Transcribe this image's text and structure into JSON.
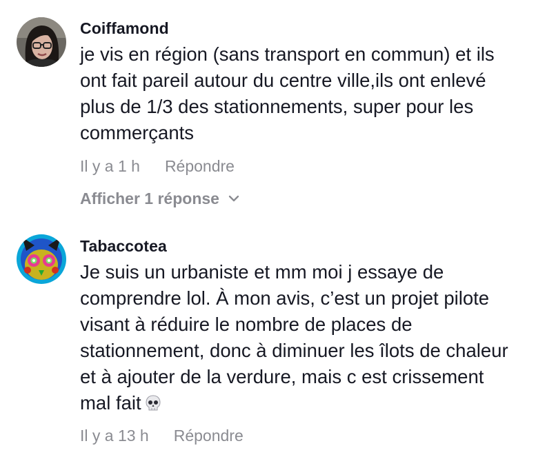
{
  "comments": [
    {
      "username": "Coiffamond",
      "text": "je vis en région (sans transport en commun) et ils\nont fait pareil autour du centre ville,ils ont enlevé\nplus de 1/3 des stationnements, super pour les\ncommerçants",
      "time": "Il y a 1 h",
      "reply_label": "Répondre",
      "view_replies_label": "Afficher 1 réponse",
      "avatar_icon": "woman-avatar-icon"
    },
    {
      "username": "Tabaccotea",
      "text": "Je suis un urbaniste et mm moi j essaye de\ncomprendre lol. À mon avis, c’est un projet pilote\nvisant à réduire le nombre de places de\nstationnement, donc à diminuer les îlots de chaleur\net à ajouter de la verdure, mais c est crissement\nmal fait",
      "emoji": "skull-emoji",
      "time": "Il y a 13 h",
      "reply_label": "Répondre",
      "avatar_icon": "pikachu-avatar-icon"
    }
  ],
  "colors": {
    "text": "#161823",
    "muted": "#8a8b91"
  }
}
